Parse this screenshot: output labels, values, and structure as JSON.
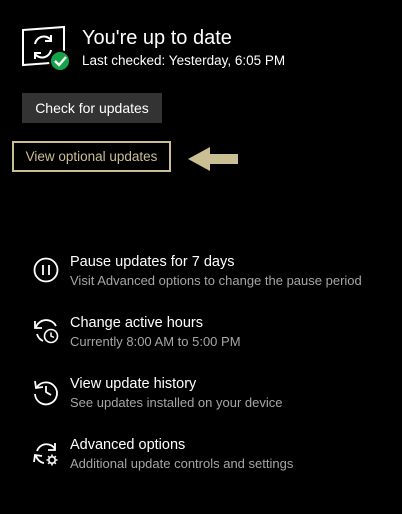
{
  "status": {
    "title": "You're up to date",
    "last_checked": "Last checked: Yesterday, 6:05 PM",
    "icon": "sync-check-icon",
    "badge_color": "#16a34a"
  },
  "check_button": {
    "label": "Check for updates"
  },
  "optional_updates": {
    "label": "View optional updates",
    "accent_color": "#c9bf93"
  },
  "pointer_arrow": {
    "icon": "left-arrow-icon",
    "color": "#c9bf93"
  },
  "options": [
    {
      "icon": "pause-icon",
      "title": "Pause updates for 7 days",
      "description": "Visit Advanced options to change the pause period"
    },
    {
      "icon": "clock-sync-icon",
      "title": "Change active hours",
      "description": "Currently 8:00 AM to 5:00 PM"
    },
    {
      "icon": "history-icon",
      "title": "View update history",
      "description": "See updates installed on your device"
    },
    {
      "icon": "sync-gear-icon",
      "title": "Advanced options",
      "description": "Additional update controls and settings"
    }
  ]
}
